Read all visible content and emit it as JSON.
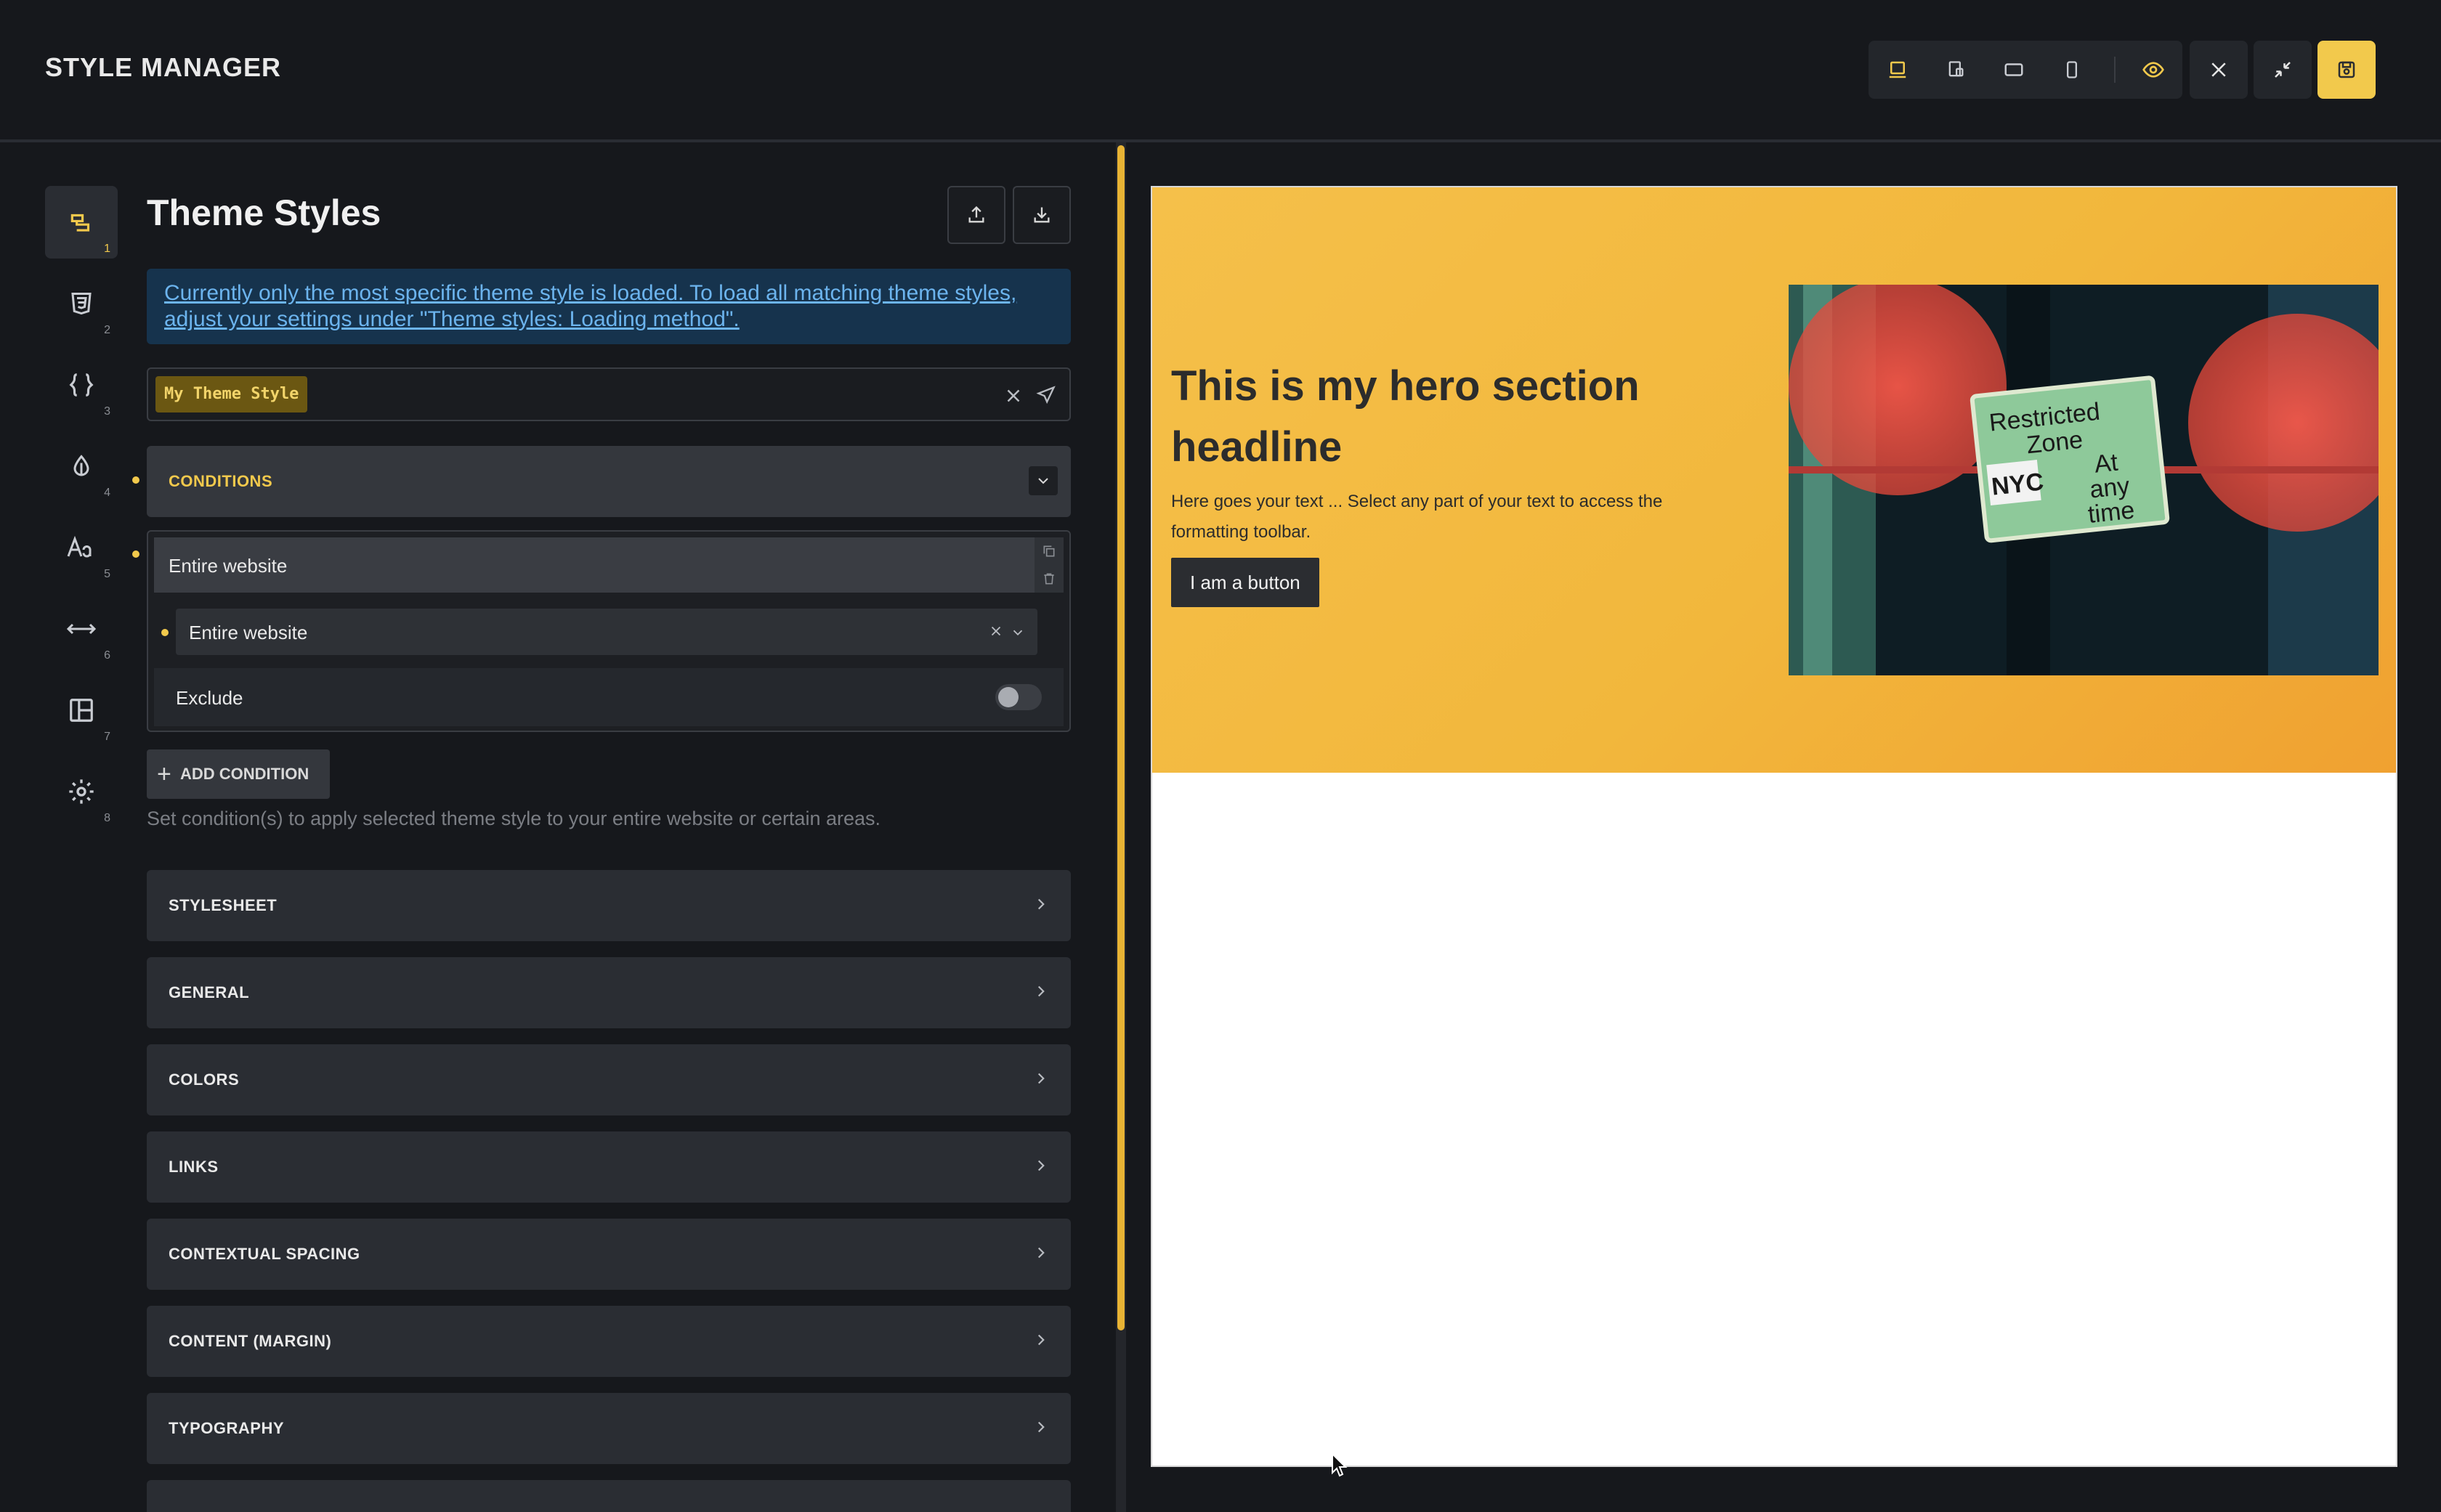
{
  "app": {
    "title": "STYLE MANAGER"
  },
  "toolbar": {
    "icons": [
      "desktop-icon",
      "laptop-icon",
      "tablet-landscape-icon",
      "mobile-icon",
      "eye-icon",
      "close-icon",
      "minimize-icon",
      "save-icon"
    ],
    "accent": "#f2c94c"
  },
  "sidebar": {
    "items": [
      {
        "icon": "theme-styles-icon",
        "num": "1"
      },
      {
        "icon": "css3-icon",
        "num": "2"
      },
      {
        "icon": "code-braces-icon",
        "num": "3"
      },
      {
        "icon": "drop-icon",
        "num": "4"
      },
      {
        "icon": "typography-icon",
        "num": "5"
      },
      {
        "icon": "spacing-arrows-icon",
        "num": "6"
      },
      {
        "icon": "layout-icon",
        "num": "7"
      },
      {
        "icon": "gear-icon",
        "num": "8"
      }
    ]
  },
  "panel": {
    "title": "Theme Styles",
    "notice": "Currently only the most specific theme style is loaded. To load all matching theme styles, adjust your settings under \"Theme styles: Loading method\".",
    "selected_theme": "My Theme Style",
    "conditions_label": "CONDITIONS",
    "condition": {
      "header": "Entire website",
      "select_value": "Entire website",
      "exclude_label": "Exclude"
    },
    "add_condition": "ADD CONDITION",
    "help": "Set condition(s) to apply selected theme style to your entire website or certain areas.",
    "sections": [
      "STYLESHEET",
      "GENERAL",
      "COLORS",
      "LINKS",
      "CONTEXTUAL SPACING",
      "CONTENT (MARGIN)",
      "TYPOGRAPHY"
    ]
  },
  "preview": {
    "hero_title": "This is my hero section headline",
    "hero_text": "Here goes your text ... Select any part of your text to access the formatting toolbar.",
    "hero_button": "I am a button",
    "image_sign_lines": [
      "Restricted",
      "Zone",
      "At",
      "any",
      "time"
    ],
    "image_sign_logo": "NYC"
  }
}
